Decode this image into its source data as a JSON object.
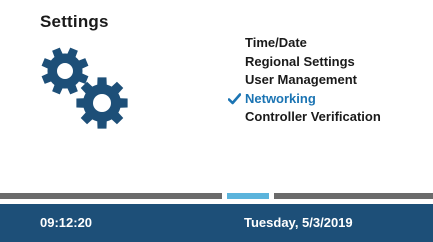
{
  "screen": {
    "title": "Settings",
    "icon": "gears-icon"
  },
  "menu": {
    "items": [
      {
        "label": "Time/Date",
        "selected": false
      },
      {
        "label": "Regional Settings",
        "selected": false
      },
      {
        "label": "User Management",
        "selected": false
      },
      {
        "label": "Networking",
        "selected": true
      },
      {
        "label": "Controller Verification",
        "selected": false
      }
    ]
  },
  "pager": {
    "current_page": 2,
    "total_pages": 3
  },
  "status_bar": {
    "time": "09:12:20",
    "date": "Tuesday, 5/3/2019"
  },
  "colors": {
    "accent": "#1b74b3",
    "icon": "#1d4f78",
    "status_bar": "#1d4f78",
    "pager_active": "#5bb4dc",
    "pager_inactive": "#6b6b6b"
  }
}
